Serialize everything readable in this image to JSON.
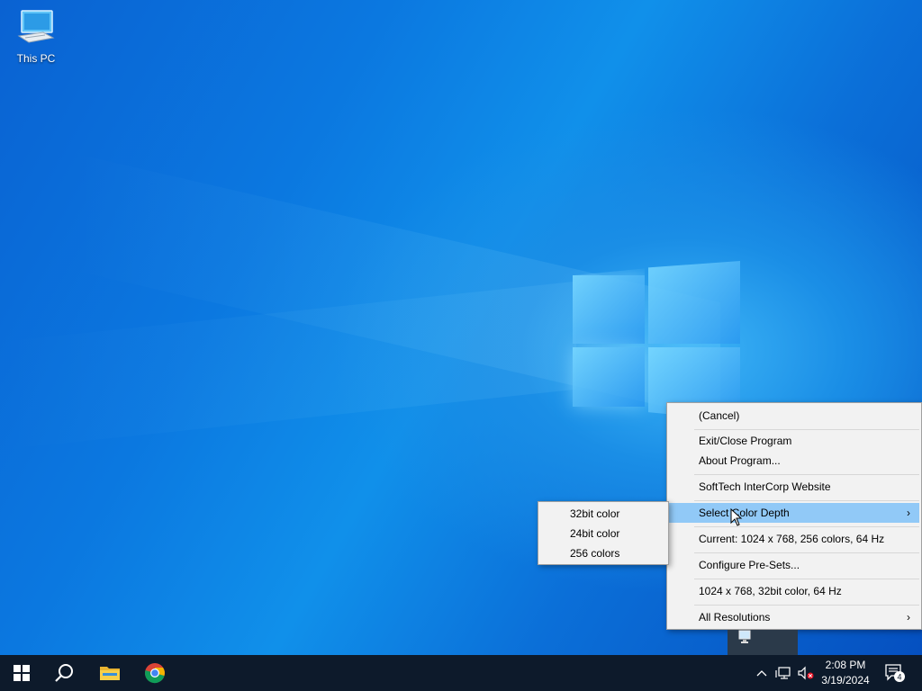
{
  "desktop": {
    "icons": [
      {
        "label": "This PC",
        "icon": "this-pc-icon"
      }
    ]
  },
  "context_menu": {
    "items": [
      {
        "label": "(Cancel)"
      },
      {
        "label": "Exit/Close Program"
      },
      {
        "label": "About Program..."
      },
      {
        "label": "SoftTech InterCorp Website"
      },
      {
        "label": "Select Color Depth",
        "submenu": true,
        "highlighted": true
      },
      {
        "label": "Current: 1024 x 768, 256 colors, 64 Hz"
      },
      {
        "label": "Configure Pre-Sets..."
      },
      {
        "label": "1024 x 768, 32bit color, 64 Hz"
      },
      {
        "label": "All Resolutions",
        "submenu": true
      }
    ],
    "highlight_color": "#91c9f7"
  },
  "submenu": {
    "items": [
      {
        "label": "32bit color"
      },
      {
        "label": "24bit color"
      },
      {
        "label": "256 colors"
      }
    ]
  },
  "taskbar": {
    "buttons": [
      {
        "name": "start",
        "icon": "windows-logo-icon"
      },
      {
        "name": "search",
        "icon": "search-icon"
      },
      {
        "name": "file-explorer",
        "icon": "folder-icon"
      },
      {
        "name": "chrome",
        "icon": "chrome-icon"
      }
    ],
    "tray": {
      "icons": [
        "chevron-up-icon",
        "network-icon",
        "volume-muted-icon"
      ],
      "time": "2:08 PM",
      "date": "3/19/2024",
      "notifications_count": "4"
    },
    "background": "#0d1a2b"
  }
}
